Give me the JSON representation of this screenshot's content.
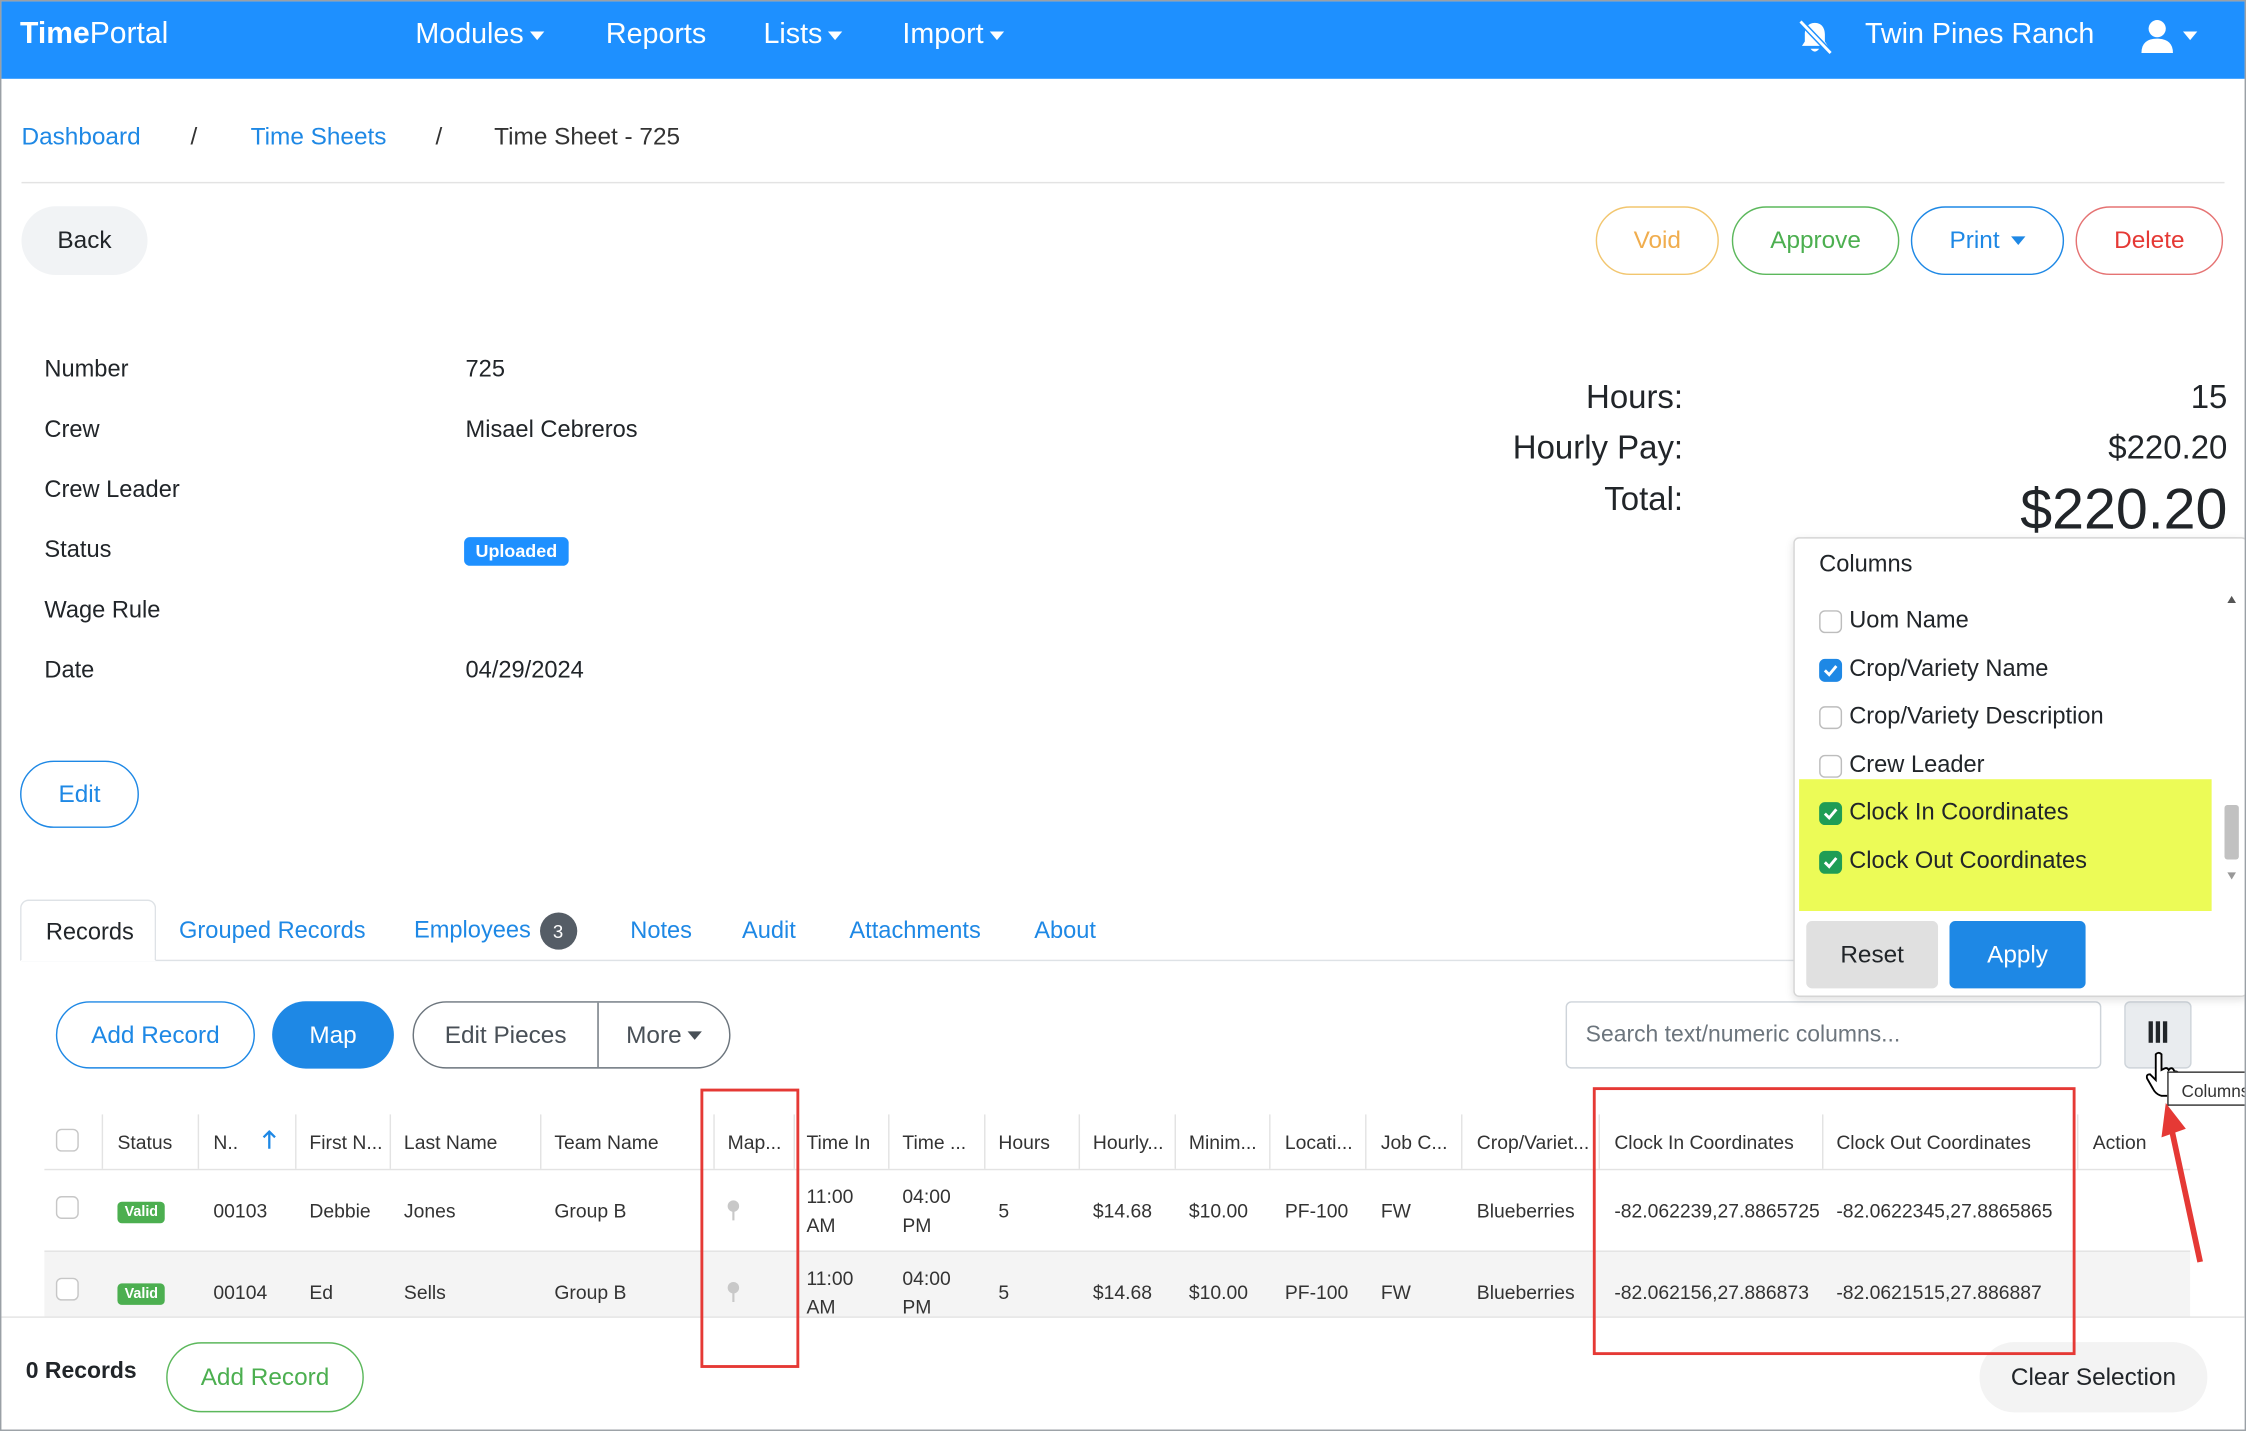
{
  "brand": {
    "bold": "Time",
    "light": "Portal"
  },
  "nav": {
    "modules": "Modules",
    "reports": "Reports",
    "lists": "Lists",
    "import": "Import",
    "ranch": "Twin Pines Ranch"
  },
  "breadcrumb": {
    "dashboard": "Dashboard",
    "timesheets": "Time Sheets",
    "current": "Time Sheet - 725",
    "sep": "/"
  },
  "actions": {
    "back": "Back",
    "void": "Void",
    "approve": "Approve",
    "print": "Print",
    "delete": "Delete",
    "edit": "Edit"
  },
  "details": {
    "labels": {
      "number": "Number",
      "crew": "Crew",
      "crew_leader": "Crew Leader",
      "status": "Status",
      "wage_rule": "Wage Rule",
      "date": "Date"
    },
    "values": {
      "number": "725",
      "crew": "Misael Cebreros",
      "status": "Uploaded",
      "date": "04/29/2024"
    }
  },
  "totals": {
    "hours_label": "Hours:",
    "hours": "15",
    "pay_label": "Hourly Pay:",
    "pay": "$220.20",
    "total_label": "Total:",
    "total": "$220.20"
  },
  "tabs": {
    "records": "Records",
    "grouped": "Grouped Records",
    "employees": "Employees",
    "employees_count": "3",
    "notes": "Notes",
    "audit": "Audit",
    "attachments": "Attachments",
    "about": "About"
  },
  "toolbar": {
    "add_record": "Add Record",
    "map": "Map",
    "edit_pieces": "Edit Pieces",
    "more": "More",
    "search_placeholder": "Search text/numeric columns...",
    "columns_tooltip": "Columns"
  },
  "table": {
    "headers": [
      "Status",
      "N..",
      "First N...",
      "Last Name",
      "Team Name",
      "Map...",
      "Time In",
      "Time ...",
      "Hours",
      "Hourly...",
      "Minim...",
      "Locati...",
      "Job C...",
      "Crop/Variet...",
      "Clock In Coordinates",
      "Clock Out Coordinates",
      "Action"
    ],
    "rows": [
      {
        "status": "Valid",
        "num": "00103",
        "first": "Debbie",
        "last": "Jones",
        "team": "Group B",
        "time_in_1": "11:00",
        "time_in_2": "AM",
        "time_out_1": "04:00",
        "time_out_2": "PM",
        "hours": "5",
        "hourly": "$14.68",
        "min": "$10.00",
        "loc": "PF-100",
        "job": "FW",
        "crop": "Blueberries",
        "clock_in": "-82.062239,27.8865725",
        "clock_out": "-82.0622345,27.8865865"
      },
      {
        "status": "Valid",
        "num": "00104",
        "first": "Ed",
        "last": "Sells",
        "team": "Group B",
        "time_in_1": "11:00",
        "time_in_2": "AM",
        "time_out_1": "04:00",
        "time_out_2": "PM",
        "hours": "5",
        "hourly": "$14.68",
        "min": "$10.00",
        "loc": "PF-100",
        "job": "FW",
        "crop": "Blueberries",
        "clock_in": "-82.062156,27.886873",
        "clock_out": "-82.0621515,27.886887"
      }
    ]
  },
  "footer": {
    "records": "0 Records",
    "add_record": "Add Record",
    "clear": "Clear Selection"
  },
  "columns_menu": {
    "title": "Columns",
    "options": [
      {
        "label": "Uom Name",
        "checked": false
      },
      {
        "label": "Crop/Variety Name",
        "checked": true
      },
      {
        "label": "Crop/Variety Description",
        "checked": false
      },
      {
        "label": "Crew Leader",
        "checked": false
      },
      {
        "label": "Clock In Coordinates",
        "checked": true
      },
      {
        "label": "Clock Out Coordinates",
        "checked": true
      }
    ],
    "reset": "Reset",
    "apply": "Apply"
  },
  "colors": {
    "primary": "#1e90ff",
    "highlight": "#ecfb57",
    "annotation": "#e53935",
    "valid": "#4caf50"
  }
}
